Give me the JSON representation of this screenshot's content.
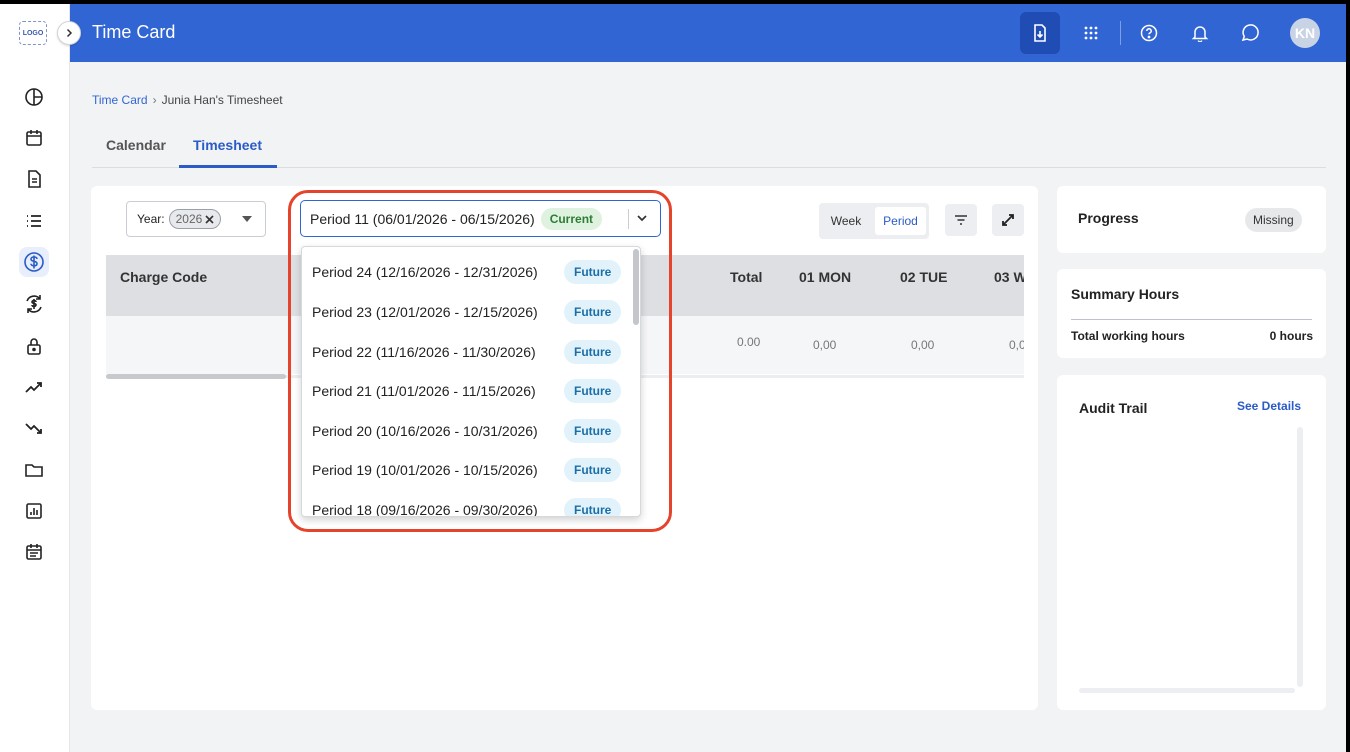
{
  "app": {
    "logo_text": "LOGO",
    "title": "Time Card",
    "avatar_initials": "KN"
  },
  "breadcrumb": {
    "root": "Time Card",
    "separator": "›",
    "current": "Junia Han's Timesheet"
  },
  "tabs": [
    {
      "label": "Calendar"
    },
    {
      "label": "Timesheet",
      "active": true
    }
  ],
  "filters": {
    "year_label": "Year:",
    "year_value": "2026",
    "period_value": "Period 11 (06/01/2026 - 06/15/2026)",
    "period_status": "Current"
  },
  "view_toggle": {
    "week": "Week",
    "period": "Period",
    "selected": "Period"
  },
  "grid": {
    "headers": {
      "charge_code": "Charge Code",
      "total": "Total",
      "d1": "01 MON",
      "d2": "02 TUE",
      "d3": "03 W"
    },
    "row": {
      "total": "0.00",
      "d1": "0,00",
      "d2": "0,00",
      "d3": "0,0"
    }
  },
  "period_options": [
    {
      "label": "Period 24 (12/16/2026 - 12/31/2026)",
      "status": "Future"
    },
    {
      "label": "Period 23 (12/01/2026 - 12/15/2026)",
      "status": "Future"
    },
    {
      "label": "Period 22 (11/16/2026 - 11/30/2026)",
      "status": "Future"
    },
    {
      "label": "Period 21 (11/01/2026 - 11/15/2026)",
      "status": "Future"
    },
    {
      "label": "Period 20 (10/16/2026 - 10/31/2026)",
      "status": "Future"
    },
    {
      "label": "Period 19 (10/01/2026 - 10/15/2026)",
      "status": "Future"
    },
    {
      "label": "Period 18 (09/16/2026 - 09/30/2026)",
      "status": "Future"
    }
  ],
  "progress": {
    "title": "Progress",
    "status": "Missing"
  },
  "summary": {
    "title": "Summary Hours",
    "label": "Total working hours",
    "value": "0 hours"
  },
  "audit": {
    "title": "Audit Trail",
    "link": "See Details"
  },
  "colors": {
    "brand": "#3165d4",
    "highlight": "#e5432b",
    "current_badge": "#dff2df",
    "future_badge": "#e1f2fb"
  }
}
